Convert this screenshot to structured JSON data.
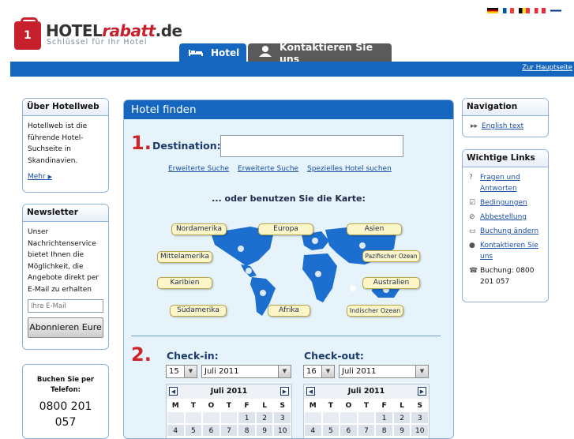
{
  "logo": {
    "brand_main": "HOTEL",
    "brand_accent": "rabatt",
    "brand_tld": ".de",
    "tagline": "Schlüssel für Ihr Hotel",
    "mark_glyph": "1"
  },
  "flags": [
    {
      "name": "flag-de",
      "colors": [
        "#000000",
        "#dd0000",
        "#ffce00"
      ]
    },
    {
      "name": "flag-fr",
      "colors": [
        "#0055a4",
        "#ffffff",
        "#ef4135"
      ]
    },
    {
      "name": "flag-be",
      "colors": [
        "#000000",
        "#fdda24",
        "#ef3340"
      ]
    },
    {
      "name": "flag-at",
      "colors": [
        "#ed2939",
        "#ffffff",
        "#ed2939"
      ]
    },
    {
      "name": "flag-fi",
      "colors": [
        "#ffffff",
        "#003580",
        "#ffffff"
      ]
    }
  ],
  "tabs": {
    "hotel": "Hotel",
    "contact": "Kontaktieren Sie uns"
  },
  "topbar": {
    "home_link": "Zur Hauptseite"
  },
  "about": {
    "title": "Über Hotellweb",
    "text": "Hotellweb ist die führende Hotel-Suchseite in Skandinavien.",
    "more": "Mehr"
  },
  "newsletter": {
    "title": "Newsletter",
    "text": "Unser Nachrichtenservice bietet Ihnen die Möglichkeit, die Angebote direkt per E-Mail zu erhalten",
    "email_placeholder": "Ihre E-Mail",
    "submit": "Abonnieren Eure"
  },
  "phone_box": {
    "label": "Buchen Sie per Telefon:",
    "number": "0800 201 057"
  },
  "main": {
    "title": "Hotel finden",
    "step1": "1.",
    "destination_label": "Destination:",
    "destination_value": "",
    "links": [
      "Erweiterte Suche",
      "Erweiterte Suche",
      "Spezielles Hotel suchen"
    ],
    "map_title": "... oder benutzen Sie die Karte:",
    "regions": [
      "Nordamerika",
      "Europa",
      "Asien",
      "Mittelamerika",
      "Pazifischer Ozean",
      "Karibien",
      "Australien",
      "Südamerika",
      "Afrika",
      "Indischer Ozean"
    ],
    "step2": "2.",
    "checkin": {
      "label": "Check-in:",
      "day": "15",
      "month": "Juli 2011",
      "cal_title": "Juli 2011"
    },
    "checkout": {
      "label": "Check-out:",
      "day": "16",
      "month": "Juli 2011",
      "cal_title": "Juli 2011"
    },
    "weekdays": [
      "M",
      "T",
      "O",
      "T",
      "F",
      "L",
      "S"
    ],
    "week1": [
      "",
      "",
      "",
      "",
      "1",
      "2",
      "3"
    ],
    "week2": [
      "4",
      "5",
      "6",
      "7",
      "8",
      "9",
      "10"
    ]
  },
  "navigation": {
    "title": "Navigation",
    "english": "English text"
  },
  "important": {
    "title": "Wichtige Links",
    "items": [
      "Fragen und Antworten",
      "Bedingungen",
      "Abbestellung",
      "Buchung ändern",
      "Kontaktieren Sie uns"
    ],
    "phone": "Buchung: 0800 201 057"
  },
  "colors": {
    "brand_blue": "#1566be",
    "accent_red": "#d1232a",
    "panel_bg": "#e6f3fb"
  }
}
